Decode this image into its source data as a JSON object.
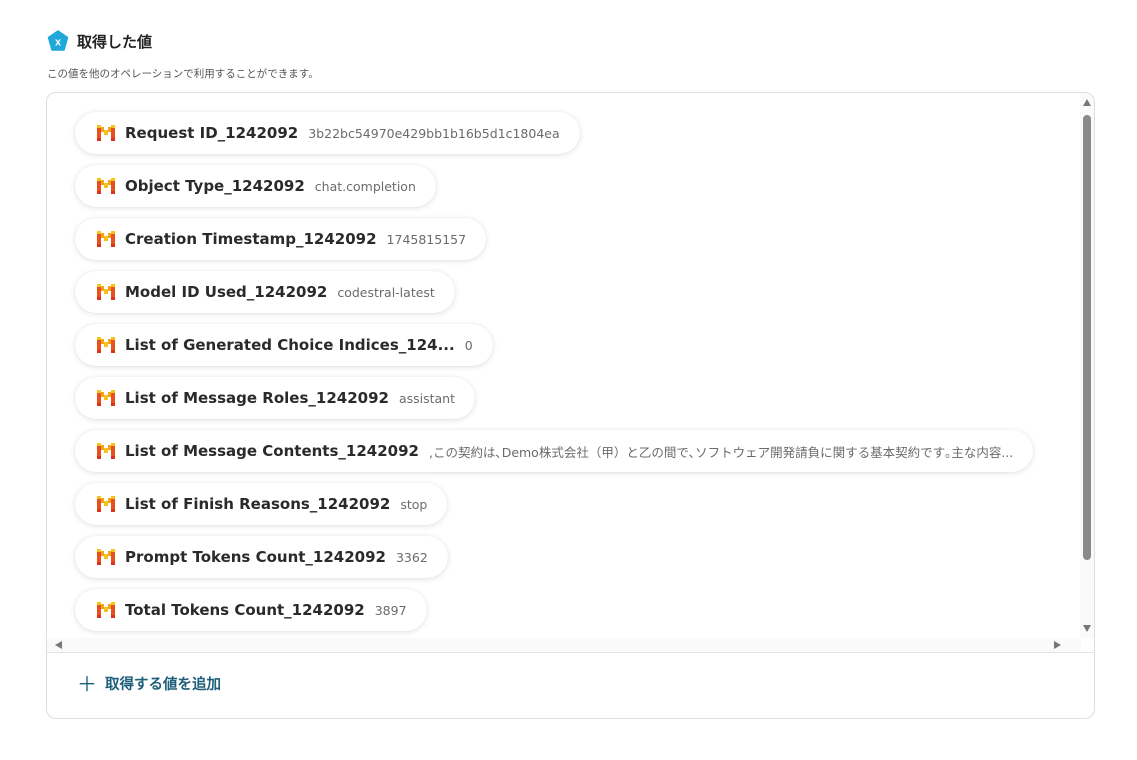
{
  "header": {
    "title": "取得した値",
    "icon": "x-badge-icon",
    "icon_letter": "x",
    "icon_color": "#1fa8d8"
  },
  "subtitle": "この値を他のオペレーションで利用することができます。",
  "items": [
    {
      "label": "Request ID_1242092",
      "value": "3b22bc54970e429bb1b16b5d1c1804ea"
    },
    {
      "label": "Object Type_1242092",
      "value": "chat.completion"
    },
    {
      "label": "Creation Timestamp_1242092",
      "value": "1745815157"
    },
    {
      "label": "Model ID Used_1242092",
      "value": "codestral-latest"
    },
    {
      "label": "List of Generated Choice Indices_124...",
      "value": "0"
    },
    {
      "label": "List of Message Roles_1242092",
      "value": "assistant"
    },
    {
      "label": "List of Message Contents_1242092",
      "value": ",この契約は､Demo株式会社（甲）と乙の間で､ソフトウェア開発請負に関する基本契約です｡主な内容..."
    },
    {
      "label": "List of Finish Reasons_1242092",
      "value": "stop"
    },
    {
      "label": "Prompt Tokens Count_1242092",
      "value": "3362"
    },
    {
      "label": "Total Tokens Count_1242092",
      "value": "3897"
    }
  ],
  "add_button": {
    "label": "取得する値を追加",
    "icon": "plus-icon"
  },
  "colors": {
    "accent": "#1f5e7a",
    "badge": "#1fa8d8"
  }
}
